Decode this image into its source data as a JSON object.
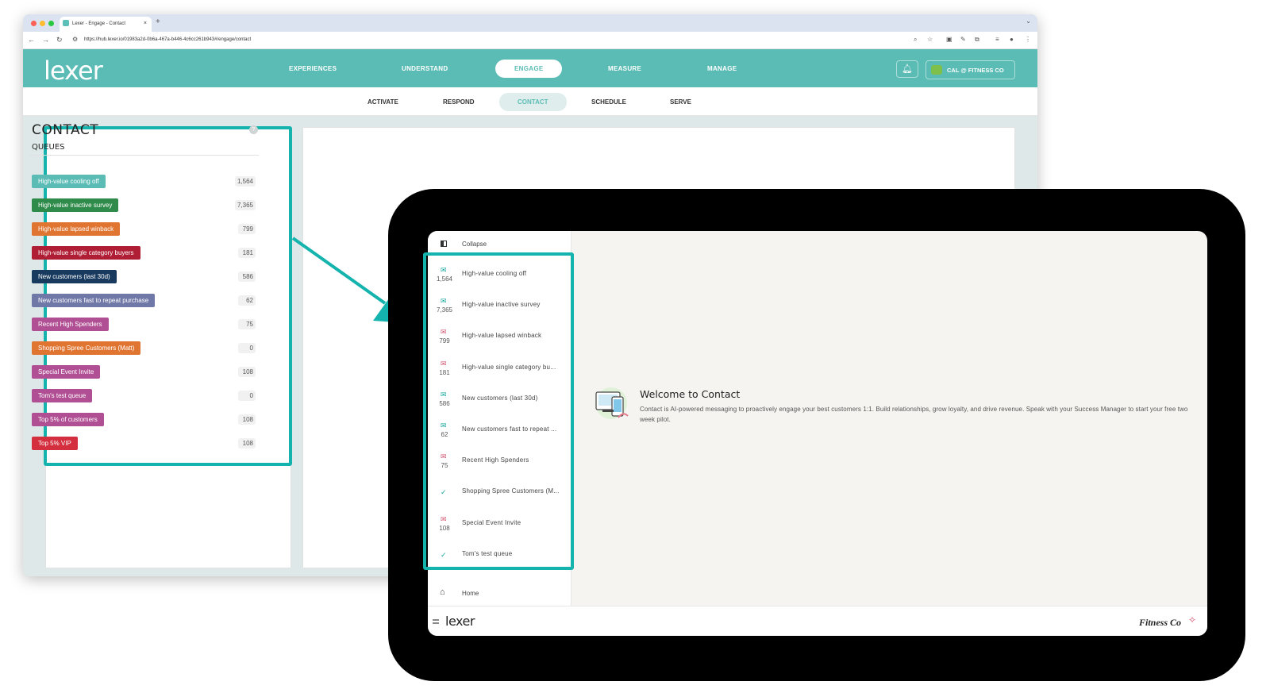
{
  "browser": {
    "tab_title": "Lexer - Engage - Contact",
    "tab_close": "×",
    "new_tab": "+",
    "url": "https://hub.lexer.io/01983a2d-0b6a-467a-b446-4c6cc261b943#/engage/contact"
  },
  "header": {
    "logo": "lexer",
    "nav": [
      "EXPERIENCES",
      "UNDERSTAND",
      "ENGAGE",
      "MEASURE",
      "MANAGE"
    ],
    "active_nav": "ENGAGE",
    "org": "CAL @ FITNESS CO"
  },
  "subnav": {
    "items": [
      "ACTIVATE",
      "RESPOND",
      "CONTACT",
      "SCHEDULE",
      "SERVE"
    ],
    "active": "CONTACT"
  },
  "contact_panel": {
    "title": "CONTACT",
    "help": "?",
    "queues_label": "QUEUES",
    "queues": [
      {
        "label": "High-value cooling off",
        "count": "1,564",
        "color": "#5bbcb5"
      },
      {
        "label": "High-value inactive survey",
        "count": "7,365",
        "color": "#2e8b4a"
      },
      {
        "label": "High-value lapsed winback",
        "count": "799",
        "color": "#e07431"
      },
      {
        "label": "High-value single category buyers",
        "count": "181",
        "color": "#b01e35"
      },
      {
        "label": "New customers (last 30d)",
        "count": "586",
        "color": "#173a5e"
      },
      {
        "label": "New customers fast to repeat purchase",
        "count": "62",
        "color": "#7078a8"
      },
      {
        "label": "Recent High Spenders",
        "count": "75",
        "color": "#b04f93"
      },
      {
        "label": "Shopping Spree Customers (Matt)",
        "count": "0",
        "color": "#e07431"
      },
      {
        "label": "Special Event Invite",
        "count": "108",
        "color": "#b04f93"
      },
      {
        "label": "Tom's test queue",
        "count": "0",
        "color": "#b04f93"
      },
      {
        "label": "Top 5% of customers",
        "count": "108",
        "color": "#b04f93"
      },
      {
        "label": "Top 5% VIP",
        "count": "108",
        "color": "#d32f3f"
      }
    ]
  },
  "tablet": {
    "collapse_label": "Collapse",
    "items": [
      {
        "label": "High-value cooling off",
        "count": "1,564",
        "icon": "mail-check-icon",
        "tone": "teal"
      },
      {
        "label": "High-value inactive survey",
        "count": "7,365",
        "icon": "mail-check-icon",
        "tone": "teal"
      },
      {
        "label": "High-value lapsed winback",
        "count": "799",
        "icon": "mail-alert-icon",
        "tone": "red"
      },
      {
        "label": "High-value single category bu...",
        "count": "181",
        "icon": "mail-alert-icon",
        "tone": "red"
      },
      {
        "label": "New customers (last 30d)",
        "count": "586",
        "icon": "mail-check-icon",
        "tone": "teal"
      },
      {
        "label": "New customers fast to repeat ...",
        "count": "62",
        "icon": "mail-check-icon",
        "tone": "teal"
      },
      {
        "label": "Recent High Spenders",
        "count": "75",
        "icon": "mail-alert-icon",
        "tone": "red"
      },
      {
        "label": "Shopping Spree Customers (M...",
        "count": "",
        "icon": "check-icon",
        "tone": "teal"
      },
      {
        "label": "Special Event Invite",
        "count": "108",
        "icon": "mail-alert-icon",
        "tone": "red"
      },
      {
        "label": "Tom's test queue",
        "count": "",
        "icon": "check-icon",
        "tone": "teal"
      }
    ],
    "home_label": "Home",
    "bottom_logo": "lexer",
    "brand": "Fitness Co",
    "welcome_title": "Welcome to Contact",
    "welcome_text": "Contact is AI-powered messaging to proactively engage your best customers 1:1. Build relationships, grow loyalty, and drive revenue. Speak with your Success Manager to start your free two week pilot."
  },
  "colors": {
    "teal": "#5bbcb5",
    "highlight": "#14b3ad"
  }
}
